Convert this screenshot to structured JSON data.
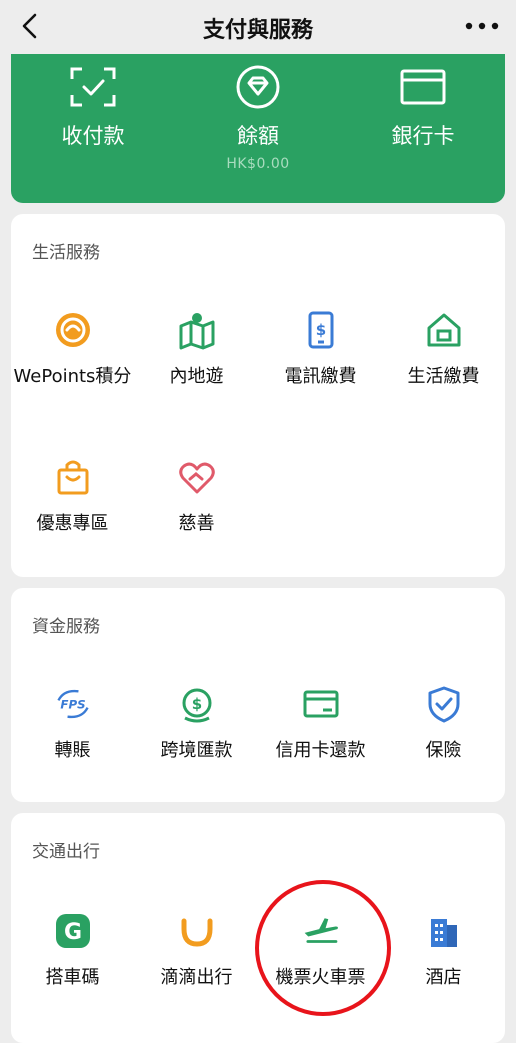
{
  "nav": {
    "title": "支付與服務"
  },
  "wallet": {
    "items": [
      {
        "label": "收付款",
        "icon": "scan-check-icon"
      },
      {
        "label": "餘額",
        "sub": "HK$0.00",
        "icon": "diamond-icon"
      },
      {
        "label": "銀行卡",
        "icon": "card-icon"
      }
    ]
  },
  "sections": {
    "life": {
      "title": "生活服務",
      "items": [
        {
          "label": "WePoints積分",
          "icon": "wepoints-icon"
        },
        {
          "label": "內地遊",
          "icon": "mainland-travel-icon"
        },
        {
          "label": "電訊繳費",
          "icon": "telecom-bill-icon"
        },
        {
          "label": "生活繳費",
          "icon": "utility-bill-icon"
        },
        {
          "label": "優惠專區",
          "icon": "gift-bag-icon"
        },
        {
          "label": "慈善",
          "icon": "charity-heart-icon"
        }
      ]
    },
    "finance": {
      "title": "資金服務",
      "items": [
        {
          "label": "轉賬",
          "icon": "fps-icon"
        },
        {
          "label": "跨境匯款",
          "icon": "remittance-icon"
        },
        {
          "label": "信用卡還款",
          "icon": "credit-card-repay-icon"
        },
        {
          "label": "保險",
          "icon": "insurance-shield-icon"
        }
      ]
    },
    "transport": {
      "title": "交通出行",
      "items": [
        {
          "label": "搭車碼",
          "icon": "ride-code-icon"
        },
        {
          "label": "滴滴出行",
          "icon": "didi-icon"
        },
        {
          "label": "機票火車票",
          "icon": "plane-train-icon"
        },
        {
          "label": "酒店",
          "icon": "hotel-icon"
        }
      ]
    }
  },
  "colors": {
    "brand_green": "#2aa162",
    "orange": "#f29c1f",
    "blue": "#3a7bd5",
    "red_highlight": "#e8141b"
  }
}
